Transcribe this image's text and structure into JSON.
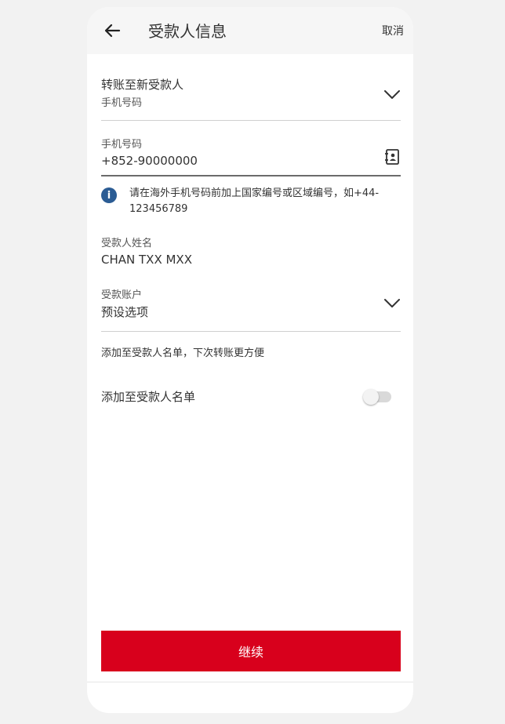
{
  "header": {
    "title": "受款人信息",
    "cancel": "取消"
  },
  "transfer_type": {
    "label": "转账至新受款人",
    "sublabel": "手机号码"
  },
  "phone": {
    "label": "手机号码",
    "value": "+852-90000000"
  },
  "info": {
    "text": "请在海外手机号码前加上国家编号或区域编号，如+44-123456789"
  },
  "payee_name": {
    "label": "受款人姓名",
    "value": "CHAN TXX MXX"
  },
  "account": {
    "label": "受款账户",
    "value": "预设选项"
  },
  "hint": "添加至受款人名单，下次转账更方便",
  "add_toggle": {
    "label": "添加至受款人名单",
    "on": false
  },
  "continue_label": "继续",
  "colors": {
    "primary_red": "#d8001c",
    "info_blue": "#2b5c94"
  }
}
